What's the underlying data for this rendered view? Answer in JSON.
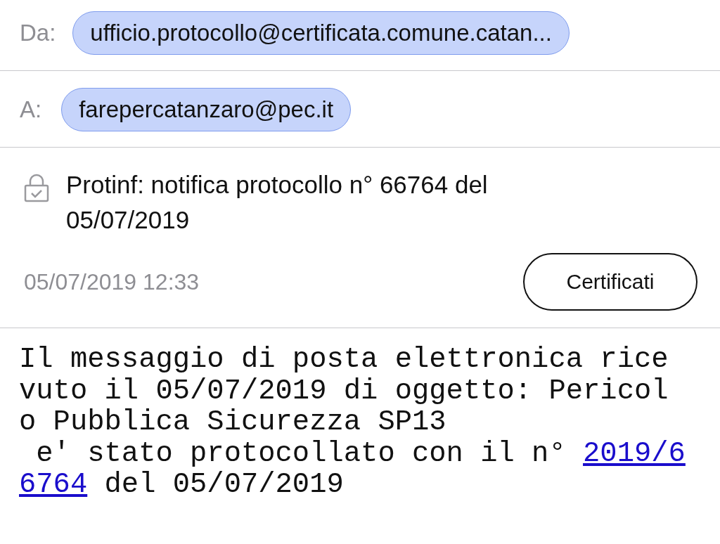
{
  "header": {
    "from": {
      "label": "Da:",
      "address": "ufficio.protocollo@certificata.comune.catan..."
    },
    "to": {
      "label": "A:",
      "address": "farepercatanzaro@pec.it"
    }
  },
  "message": {
    "signed": true,
    "subject": "Protinf: notifica protocollo n° 66764 del 05/07/2019",
    "date": "05/07/2019 12:33",
    "certificates_button": "Certificati"
  },
  "body": {
    "text_before": "Il messaggio di posta elettronica rice\nvuto il 05/07/2019 di oggetto: Pericol\no Pubblica Sicurezza SP13\n e' stato protocollato con il n° ",
    "link_parts": [
      "2019/6",
      "6764"
    ],
    "text_after": " del 05/07/2019"
  }
}
